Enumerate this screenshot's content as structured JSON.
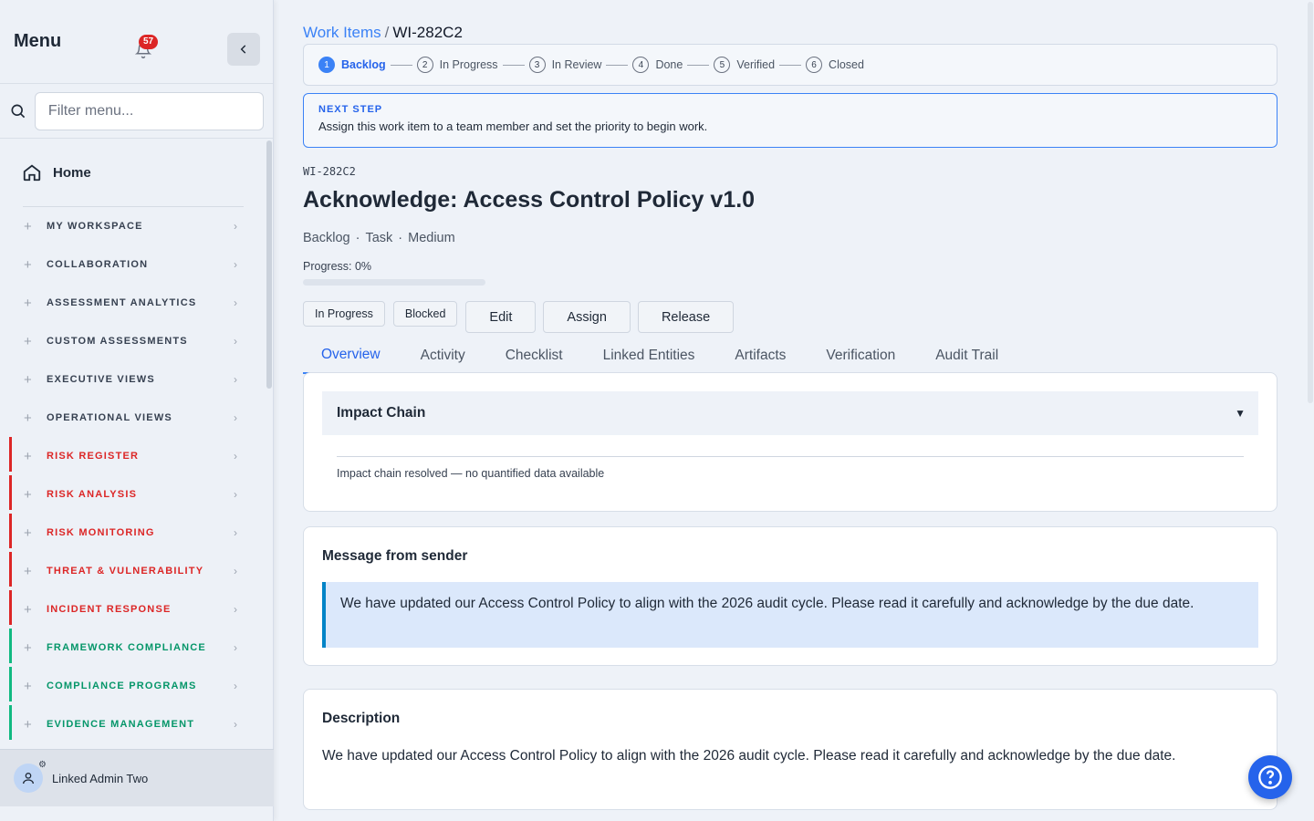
{
  "sidebar": {
    "title": "Menu",
    "notification_count": "57",
    "filter_placeholder": "Filter menu...",
    "home_label": "Home",
    "sections": [
      {
        "label": "MY WORKSPACE",
        "color": "gray"
      },
      {
        "label": "COLLABORATION",
        "color": "gray"
      },
      {
        "label": "ASSESSMENT ANALYTICS",
        "color": "gray"
      },
      {
        "label": "CUSTOM ASSESSMENTS",
        "color": "gray"
      },
      {
        "label": "EXECUTIVE VIEWS",
        "color": "gray"
      },
      {
        "label": "OPERATIONAL VIEWS",
        "color": "gray"
      },
      {
        "label": "RISK REGISTER",
        "color": "red"
      },
      {
        "label": "RISK ANALYSIS",
        "color": "red"
      },
      {
        "label": "RISK MONITORING",
        "color": "red"
      },
      {
        "label": "THREAT & VULNERABILITY",
        "color": "red"
      },
      {
        "label": "INCIDENT RESPONSE",
        "color": "red"
      },
      {
        "label": "FRAMEWORK COMPLIANCE",
        "color": "green"
      },
      {
        "label": "COMPLIANCE PROGRAMS",
        "color": "green"
      },
      {
        "label": "EVIDENCE MANAGEMENT",
        "color": "green"
      }
    ],
    "user_name": "Linked Admin Two"
  },
  "breadcrumb": {
    "parent": "Work Items",
    "separator": "/",
    "current": "WI-282C2"
  },
  "stepper": [
    {
      "num": "1",
      "label": "Backlog",
      "active": true
    },
    {
      "num": "2",
      "label": "In Progress",
      "active": false
    },
    {
      "num": "3",
      "label": "In Review",
      "active": false
    },
    {
      "num": "4",
      "label": "Done",
      "active": false
    },
    {
      "num": "5",
      "label": "Verified",
      "active": false
    },
    {
      "num": "6",
      "label": "Closed",
      "active": false
    }
  ],
  "next_step": {
    "label": "NEXT STEP",
    "text": "Assign this work item to a team member and set the priority to begin work."
  },
  "work_item": {
    "id": "WI-282C2",
    "title": "Acknowledge: Access Control Policy v1.0",
    "status": "Backlog",
    "type": "Task",
    "priority": "Medium",
    "progress_label": "Progress: 0%",
    "progress_value": 0
  },
  "actions": {
    "in_progress": "In Progress",
    "blocked": "Blocked",
    "edit": "Edit",
    "assign": "Assign",
    "release": "Release"
  },
  "tabs": [
    "Overview",
    "Activity",
    "Checklist",
    "Linked Entities",
    "Artifacts",
    "Verification",
    "Audit Trail"
  ],
  "impact_chain": {
    "title": "Impact Chain",
    "text": "Impact chain resolved — no quantified data available"
  },
  "message": {
    "title": "Message from sender",
    "text": "We have updated our Access Control Policy to align with the 2026 audit cycle. Please read it carefully and acknowledge by the due date."
  },
  "description": {
    "title": "Description",
    "text": "We have updated our Access Control Policy to align with the 2026 audit cycle. Please read it carefully and acknowledge by the due date."
  },
  "colors": {
    "accent": "#3b82f6",
    "risk": "#dc2626",
    "compliance": "#059669",
    "message_border": "#0284c7"
  }
}
